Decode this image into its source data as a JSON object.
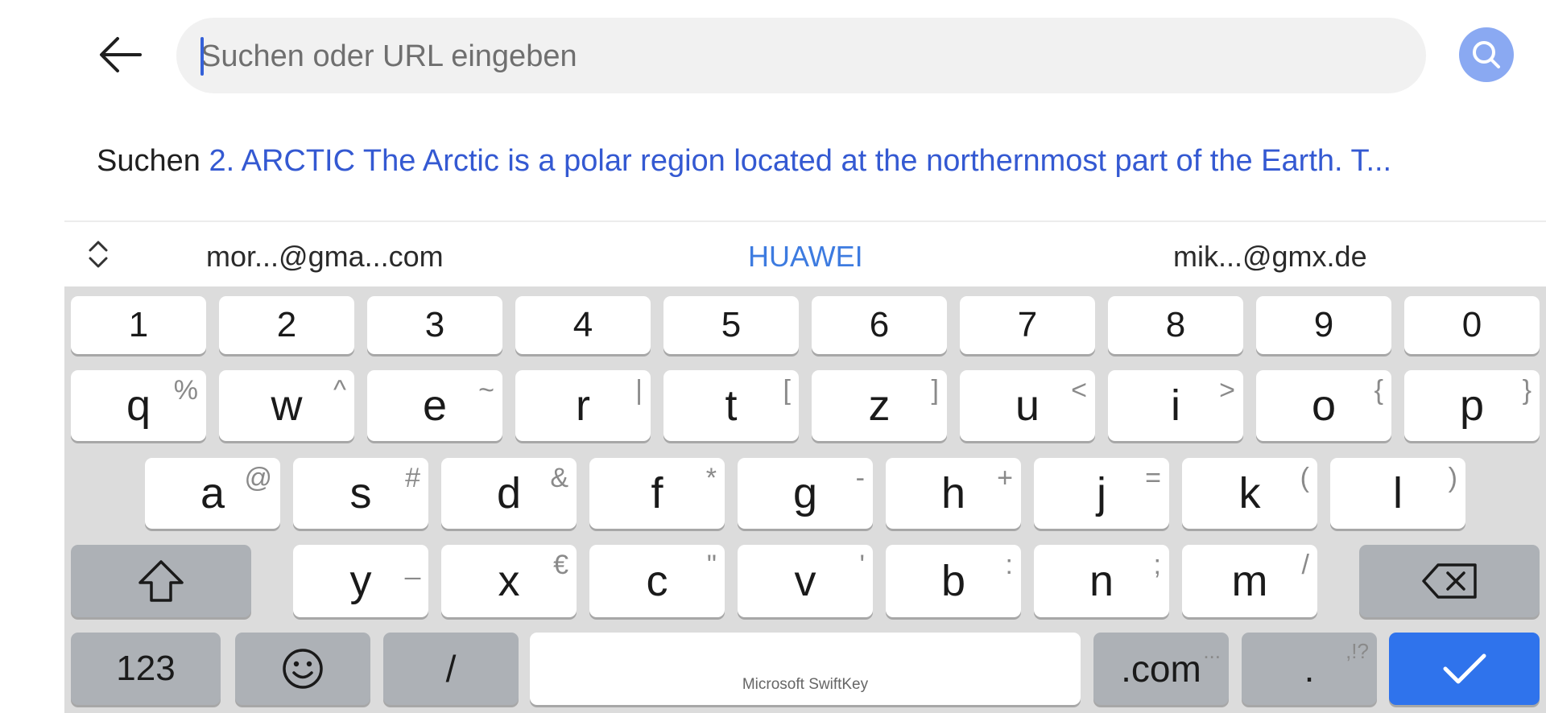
{
  "search": {
    "placeholder": "Suchen oder URL eingeben",
    "value": ""
  },
  "suggestion": {
    "prefix": "Suchen",
    "text": "2. ARCTIC The Arctic is a polar region located at the northernmost part of the Earth. T..."
  },
  "keyboard": {
    "brand": "Microsoft SwiftKey",
    "suggestions": [
      "mor...@gma...com",
      "HUAWEI",
      "mik...@gmx.de"
    ],
    "number_row": [
      "1",
      "2",
      "3",
      "4",
      "5",
      "6",
      "7",
      "8",
      "9",
      "0"
    ],
    "row1": [
      {
        "key": "q",
        "alt": "%"
      },
      {
        "key": "w",
        "alt": "^"
      },
      {
        "key": "e",
        "alt": "~"
      },
      {
        "key": "r",
        "alt": "|"
      },
      {
        "key": "t",
        "alt": "["
      },
      {
        "key": "z",
        "alt": "]"
      },
      {
        "key": "u",
        "alt": "<"
      },
      {
        "key": "i",
        "alt": ">"
      },
      {
        "key": "o",
        "alt": "{"
      },
      {
        "key": "p",
        "alt": "}"
      }
    ],
    "row2": [
      {
        "key": "a",
        "alt": "@"
      },
      {
        "key": "s",
        "alt": "#"
      },
      {
        "key": "d",
        "alt": "&"
      },
      {
        "key": "f",
        "alt": "*"
      },
      {
        "key": "g",
        "alt": "-"
      },
      {
        "key": "h",
        "alt": "+"
      },
      {
        "key": "j",
        "alt": "="
      },
      {
        "key": "k",
        "alt": "("
      },
      {
        "key": "l",
        "alt": ")"
      }
    ],
    "row3": [
      {
        "key": "y",
        "alt": "_"
      },
      {
        "key": "x",
        "alt": "€"
      },
      {
        "key": "c",
        "alt": "\""
      },
      {
        "key": "v",
        "alt": "'"
      },
      {
        "key": "b",
        "alt": ":"
      },
      {
        "key": "n",
        "alt": ";"
      },
      {
        "key": "m",
        "alt": "/"
      }
    ],
    "bottom": {
      "numbers_label": "123",
      "slash_label": "/",
      "dotcom_label": ".com",
      "dotcom_alt": "...",
      "period_label": ".",
      "period_alt": ",!?"
    }
  },
  "colors": {
    "accent": "#2f73ec",
    "link": "#3459d2",
    "search_button": "#8aa9f2",
    "keyboard_bg": "#dcdcdc"
  }
}
